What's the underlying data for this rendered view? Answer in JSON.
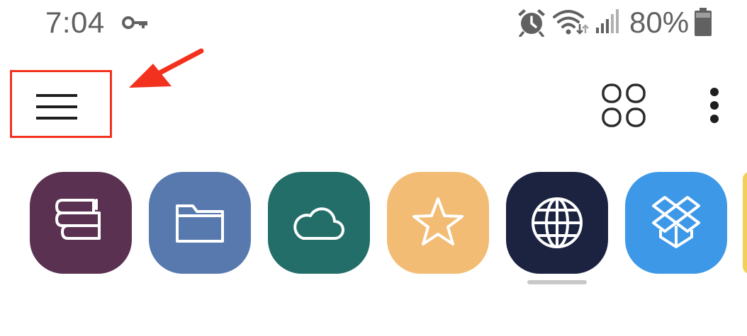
{
  "status_bar": {
    "time": "7:04",
    "battery_percent": "80%",
    "icons": [
      "key-icon",
      "alarm-icon",
      "wifi-icon",
      "signal-icon",
      "battery-icon"
    ],
    "text_color": "#616161"
  },
  "app_bar": {
    "menu_icon": "hamburger-menu-icon",
    "tabs_icon": "tabs-grid-icon",
    "more_icon": "more-vertical-icon",
    "highlight_color": "#f2321e"
  },
  "tiles": [
    {
      "id": "books",
      "icon": "books-icon",
      "color": "#5a3151"
    },
    {
      "id": "folder",
      "icon": "folder-icon",
      "color": "#5779ad"
    },
    {
      "id": "cloud",
      "icon": "cloud-icon",
      "color": "#236e68"
    },
    {
      "id": "bookmarks",
      "icon": "star-icon",
      "color": "#f3bc74"
    },
    {
      "id": "internet",
      "icon": "globe-icon",
      "color": "#1b2340",
      "selected": true
    },
    {
      "id": "dropbox",
      "icon": "dropbox-icon",
      "color": "#3d98e8"
    },
    {
      "id": "partial",
      "icon": "",
      "color": "#f3cf5a"
    }
  ]
}
